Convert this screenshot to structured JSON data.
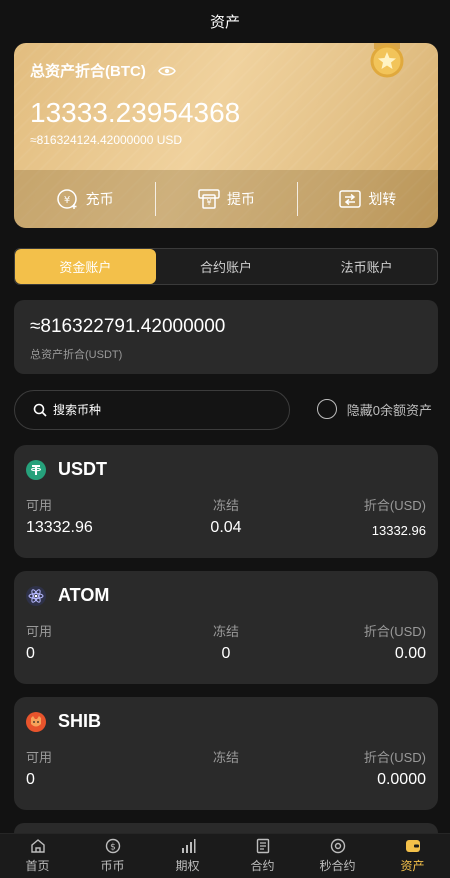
{
  "header": {
    "title": "资产"
  },
  "hero": {
    "title": "总资产折合(BTC)",
    "amount": "13333.23954368",
    "usd": "≈816324124.42000000 USD",
    "actions": [
      {
        "label": "充币",
        "icon": "deposit-icon"
      },
      {
        "label": "提币",
        "icon": "withdraw-icon"
      },
      {
        "label": "划转",
        "icon": "transfer-icon"
      }
    ]
  },
  "tabs": [
    {
      "label": "资金账户",
      "active": true
    },
    {
      "label": "合约账户",
      "active": false
    },
    {
      "label": "法币账户",
      "active": false
    }
  ],
  "usdt_summary": {
    "value": "≈816322791.42000000",
    "label": "总资产折合(USDT)"
  },
  "search": {
    "placeholder": "搜索币种",
    "hide_zero_label": "隐藏0余额资产"
  },
  "columns": {
    "available": "可用",
    "frozen": "冻结",
    "converted": "折合(USD)"
  },
  "assets": [
    {
      "name": "USDT",
      "available": "13332.96",
      "frozen": "0.04",
      "converted": "13332.96"
    },
    {
      "name": "ATOM",
      "available": "0",
      "frozen": "0",
      "converted": "0.00"
    },
    {
      "name": "SHIB",
      "available": "0",
      "frozen": "",
      "converted": "0.0000"
    }
  ],
  "nav": [
    {
      "label": "首页",
      "icon": "home-icon",
      "active": false
    },
    {
      "label": "币币",
      "icon": "coin-icon",
      "active": false
    },
    {
      "label": "期权",
      "icon": "chart-bars-icon",
      "active": false
    },
    {
      "label": "合约",
      "icon": "document-icon",
      "active": false
    },
    {
      "label": "秒合约",
      "icon": "target-icon",
      "active": false
    },
    {
      "label": "资产",
      "icon": "wallet-icon",
      "active": true
    }
  ],
  "colors": {
    "accent": "#f3c04a",
    "card": "#2a2a2a",
    "background": "#121212"
  }
}
